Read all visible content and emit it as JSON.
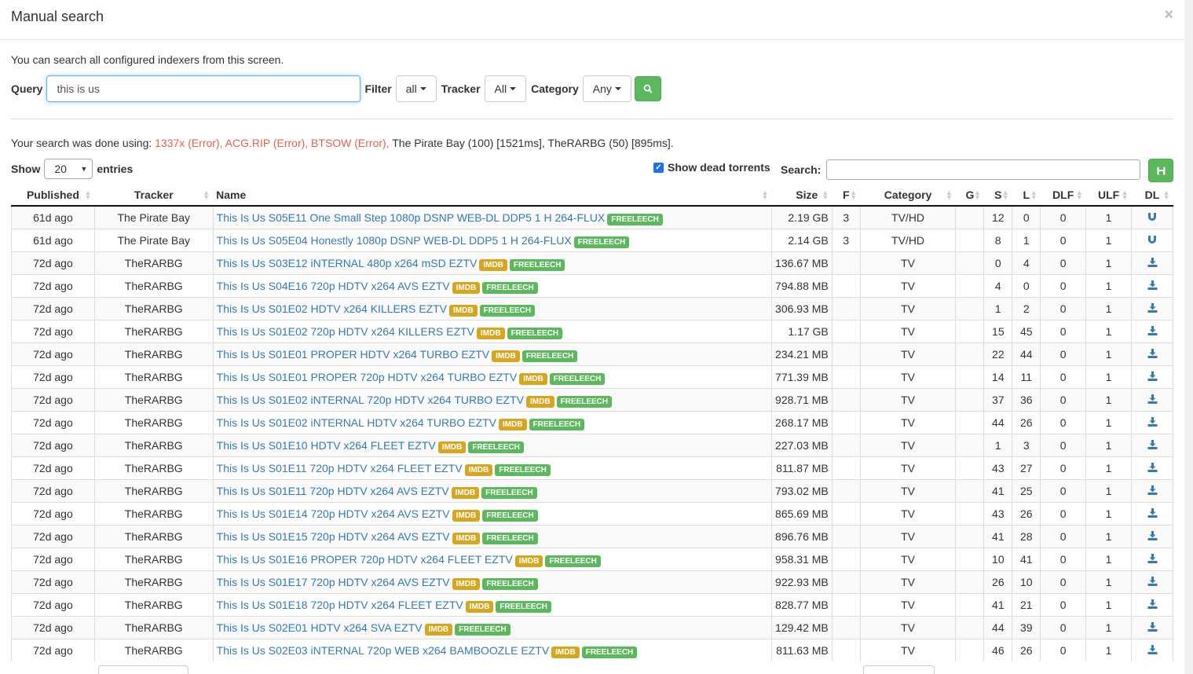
{
  "modal": {
    "title": "Manual search",
    "close": "×",
    "intro": "You can search all configured indexers from this screen."
  },
  "query": {
    "label": "Query",
    "value": "this is us",
    "filter_label": "Filter",
    "filter_value": "all",
    "tracker_label": "Tracker",
    "tracker_value": "All",
    "category_label": "Category",
    "category_value": "Any"
  },
  "search_summary": {
    "prefix": "Your search was done using: ",
    "errors": "1337x (Error), ACG.RIP (Error), BTSOW (Error),",
    "results": " The Pirate Bay (100) [1521ms], TheRARBG (50) [895ms]."
  },
  "table_controls": {
    "show_label": "Show",
    "entries_value": "20",
    "entries_label": "entries",
    "show_dead_label": "Show dead torrents",
    "search_label": "Search:"
  },
  "columns": [
    "Published",
    "Tracker",
    "Name",
    "Size",
    "F",
    "Category",
    "G",
    "S",
    "L",
    "DLF",
    "ULF",
    "DL"
  ],
  "labels": {
    "imdb": "IMDB",
    "free": "FREELEECH"
  },
  "rows": [
    {
      "pub": "61d ago",
      "tracker": "The Pirate Bay",
      "name": "This Is Us S05E11 One Small Step 1080p DSNP WEB-DL DDP5 1 H 264-FLUX",
      "imdb": false,
      "size": "2.19 GB",
      "f": "3",
      "cat": "TV/HD",
      "s": "12",
      "l": "0",
      "dlf": "0",
      "ulf": "1",
      "dl": "magnet"
    },
    {
      "pub": "61d ago",
      "tracker": "The Pirate Bay",
      "name": "This Is Us S05E04 Honestly 1080p DSNP WEB-DL DDP5 1 H 264-FLUX",
      "imdb": false,
      "size": "2.14 GB",
      "f": "3",
      "cat": "TV/HD",
      "s": "8",
      "l": "1",
      "dlf": "0",
      "ulf": "1",
      "dl": "magnet"
    },
    {
      "pub": "72d ago",
      "tracker": "TheRARBG",
      "name": "This Is Us S03E12 iNTERNAL 480p x264 mSD EZTV",
      "imdb": true,
      "size": "136.67 MB",
      "f": "",
      "cat": "TV",
      "s": "0",
      "l": "4",
      "dlf": "0",
      "ulf": "1",
      "dl": "download"
    },
    {
      "pub": "72d ago",
      "tracker": "TheRARBG",
      "name": "This Is Us S04E16 720p HDTV x264 AVS EZTV",
      "imdb": true,
      "size": "794.88 MB",
      "f": "",
      "cat": "TV",
      "s": "4",
      "l": "0",
      "dlf": "0",
      "ulf": "1",
      "dl": "download"
    },
    {
      "pub": "72d ago",
      "tracker": "TheRARBG",
      "name": "This Is Us S01E02 HDTV x264 KILLERS EZTV",
      "imdb": true,
      "size": "306.93 MB",
      "f": "",
      "cat": "TV",
      "s": "1",
      "l": "2",
      "dlf": "0",
      "ulf": "1",
      "dl": "download"
    },
    {
      "pub": "72d ago",
      "tracker": "TheRARBG",
      "name": "This Is Us S01E02 720p HDTV x264 KILLERS EZTV",
      "imdb": true,
      "size": "1.17 GB",
      "f": "",
      "cat": "TV",
      "s": "15",
      "l": "45",
      "dlf": "0",
      "ulf": "1",
      "dl": "download"
    },
    {
      "pub": "72d ago",
      "tracker": "TheRARBG",
      "name": "This Is Us S01E01 PROPER HDTV x264 TURBO EZTV",
      "imdb": true,
      "size": "234.21 MB",
      "f": "",
      "cat": "TV",
      "s": "22",
      "l": "44",
      "dlf": "0",
      "ulf": "1",
      "dl": "download"
    },
    {
      "pub": "72d ago",
      "tracker": "TheRARBG",
      "name": "This Is Us S01E01 PROPER 720p HDTV x264 TURBO EZTV",
      "imdb": true,
      "size": "771.39 MB",
      "f": "",
      "cat": "TV",
      "s": "14",
      "l": "11",
      "dlf": "0",
      "ulf": "1",
      "dl": "download"
    },
    {
      "pub": "72d ago",
      "tracker": "TheRARBG",
      "name": "This Is Us S01E02 iNTERNAL 720p HDTV x264 TURBO EZTV",
      "imdb": true,
      "size": "928.71 MB",
      "f": "",
      "cat": "TV",
      "s": "37",
      "l": "36",
      "dlf": "0",
      "ulf": "1",
      "dl": "download"
    },
    {
      "pub": "72d ago",
      "tracker": "TheRARBG",
      "name": "This Is Us S01E02 iNTERNAL HDTV x264 TURBO EZTV",
      "imdb": true,
      "size": "268.17 MB",
      "f": "",
      "cat": "TV",
      "s": "44",
      "l": "26",
      "dlf": "0",
      "ulf": "1",
      "dl": "download"
    },
    {
      "pub": "72d ago",
      "tracker": "TheRARBG",
      "name": "This Is Us S01E10 HDTV x264 FLEET EZTV",
      "imdb": true,
      "size": "227.03 MB",
      "f": "",
      "cat": "TV",
      "s": "1",
      "l": "3",
      "dlf": "0",
      "ulf": "1",
      "dl": "download"
    },
    {
      "pub": "72d ago",
      "tracker": "TheRARBG",
      "name": "This Is Us S01E11 720p HDTV x264 FLEET EZTV",
      "imdb": true,
      "size": "811.87 MB",
      "f": "",
      "cat": "TV",
      "s": "43",
      "l": "27",
      "dlf": "0",
      "ulf": "1",
      "dl": "download"
    },
    {
      "pub": "72d ago",
      "tracker": "TheRARBG",
      "name": "This Is Us S01E11 720p HDTV x264 AVS EZTV",
      "imdb": true,
      "size": "793.02 MB",
      "f": "",
      "cat": "TV",
      "s": "41",
      "l": "25",
      "dlf": "0",
      "ulf": "1",
      "dl": "download"
    },
    {
      "pub": "72d ago",
      "tracker": "TheRARBG",
      "name": "This Is Us S01E14 720p HDTV x264 AVS EZTV",
      "imdb": true,
      "size": "865.69 MB",
      "f": "",
      "cat": "TV",
      "s": "43",
      "l": "26",
      "dlf": "0",
      "ulf": "1",
      "dl": "download"
    },
    {
      "pub": "72d ago",
      "tracker": "TheRARBG",
      "name": "This Is Us S01E15 720p HDTV x264 AVS EZTV",
      "imdb": true,
      "size": "896.76 MB",
      "f": "",
      "cat": "TV",
      "s": "41",
      "l": "28",
      "dlf": "0",
      "ulf": "1",
      "dl": "download"
    },
    {
      "pub": "72d ago",
      "tracker": "TheRARBG",
      "name": "This Is Us S01E16 PROPER 720p HDTV x264 FLEET EZTV",
      "imdb": true,
      "size": "958.31 MB",
      "f": "",
      "cat": "TV",
      "s": "10",
      "l": "41",
      "dlf": "0",
      "ulf": "1",
      "dl": "download"
    },
    {
      "pub": "72d ago",
      "tracker": "TheRARBG",
      "name": "This Is Us S01E17 720p HDTV x264 AVS EZTV",
      "imdb": true,
      "size": "922.93 MB",
      "f": "",
      "cat": "TV",
      "s": "26",
      "l": "10",
      "dlf": "0",
      "ulf": "1",
      "dl": "download"
    },
    {
      "pub": "72d ago",
      "tracker": "TheRARBG",
      "name": "This Is Us S01E18 720p HDTV x264 FLEET EZTV",
      "imdb": true,
      "size": "828.77 MB",
      "f": "",
      "cat": "TV",
      "s": "41",
      "l": "21",
      "dlf": "0",
      "ulf": "1",
      "dl": "download"
    },
    {
      "pub": "72d ago",
      "tracker": "TheRARBG",
      "name": "This Is Us S02E01 HDTV x264 SVA EZTV",
      "imdb": true,
      "size": "129.42 MB",
      "f": "",
      "cat": "TV",
      "s": "44",
      "l": "39",
      "dlf": "0",
      "ulf": "1",
      "dl": "download"
    },
    {
      "pub": "72d ago",
      "tracker": "TheRARBG",
      "name": "This Is Us S02E03 iNTERNAL 720p WEB x264 BAMBOOZLE EZTV",
      "imdb": true,
      "size": "811.63 MB",
      "f": "",
      "cat": "TV",
      "s": "46",
      "l": "26",
      "dlf": "0",
      "ulf": "1",
      "dl": "download"
    }
  ]
}
